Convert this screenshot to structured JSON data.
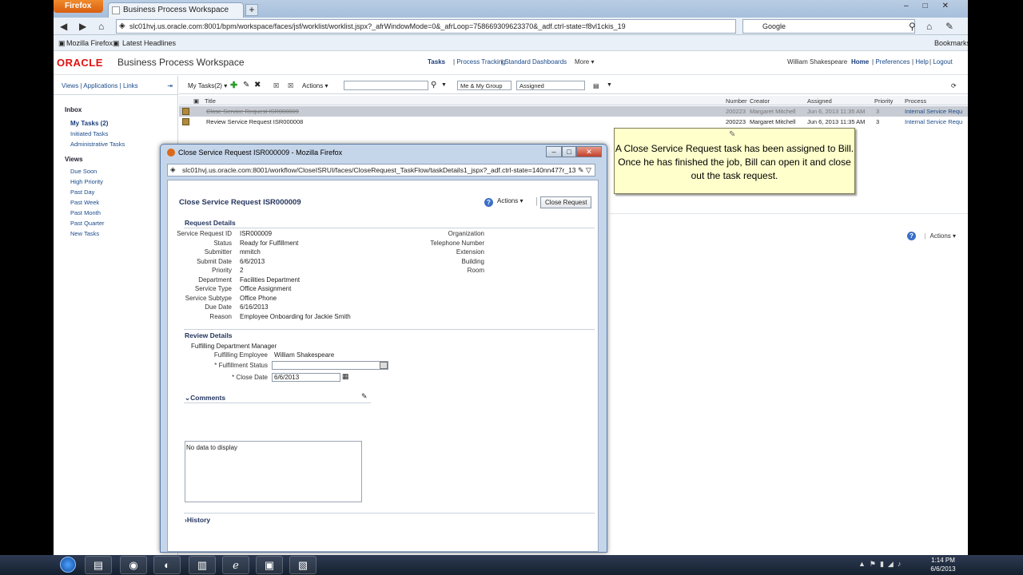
{
  "browser": {
    "button": "Firefox",
    "tab_title": "Business Process Workspace",
    "url": "slc01hvj.us.oracle.com:8001/bpm/workspace/faces/jsf/worklist/worklist.jspx?_afrWindowMode=0&_afrLoop=758669309623370&_adf.ctrl-state=f8vl1ckis_19",
    "search_placeholder": "Google",
    "bookmarks": [
      "Mozilla Firefox",
      "Latest Headlines"
    ],
    "bookmarks_menu": "Bookmarks"
  },
  "header": {
    "logo": "ORACLE",
    "app_title": "Business Process Workspace",
    "nav": [
      "Tasks",
      "Process Tracking",
      "Standard Dashboards",
      "More ▾"
    ],
    "user": "William Shakespeare",
    "links": [
      "Home",
      "Preferences",
      "Help",
      "Logout"
    ]
  },
  "sidebar": {
    "tabs": [
      "Views",
      "Applications",
      "Links"
    ],
    "inbox_heading": "Inbox",
    "inbox": [
      "My Tasks (2)",
      "Initiated Tasks",
      "Administrative Tasks"
    ],
    "views_heading": "Views",
    "views": [
      "Due Soon",
      "High Priority",
      "Past Day",
      "Past Week",
      "Past Month",
      "Past Quarter",
      "New Tasks"
    ]
  },
  "toolbar": {
    "my_tasks": "My Tasks(2) ▾",
    "actions": "Actions ▾",
    "group_filter": "Me & My Group",
    "state_filter": "Assigned"
  },
  "worklist": {
    "columns": [
      "Title",
      "Number",
      "Creator",
      "Assigned",
      "Priority",
      "Process"
    ],
    "rows": [
      {
        "title": "Close Service Request ISR000009",
        "number": "200223",
        "creator": "Margaret Mitchell",
        "assigned": "Jun 6, 2013 11:35 AM",
        "priority": "3",
        "process": "Internal Service Requ"
      },
      {
        "title": "Review Service Request ISR000008",
        "number": "200223",
        "creator": "Margaret Mitchell",
        "assigned": "Jun 6, 2013 11:35 AM",
        "priority": "3",
        "process": "Internal Service Requ"
      }
    ]
  },
  "detail_panel": {
    "actions": "Actions ▾"
  },
  "callout": {
    "text": "A Close Service Request task has been assigned to Bill. Once he has finished the job, Bill can open it and close out the task request."
  },
  "popup": {
    "window_title": "Close Service Request ISR000009 - Mozilla Firefox",
    "url": "slc01hvj.us.oracle.com:8001/workflow/CloseISRUI/faces/CloseRequest_TaskFlow/taskDetails1_jspx?_adf.ctrl-state=140nn477r_13",
    "form_title": "Close Service Request ISR000009",
    "actions": "Actions ▾",
    "close_button": "Close Request",
    "request_details_heading": "Request Details",
    "request_fields": [
      {
        "label": "Service Request ID",
        "value": "ISR000009"
      },
      {
        "label": "Status",
        "value": "Ready for Fulfillment"
      },
      {
        "label": "Submitter",
        "value": "mmitch"
      },
      {
        "label": "Submit Date",
        "value": "6/6/2013"
      },
      {
        "label": "Priority",
        "value": "2"
      },
      {
        "label": "Department",
        "value": "Facilities Department"
      },
      {
        "label": "Service Type",
        "value": "Office Assignment"
      },
      {
        "label": "Service Subtype",
        "value": "Office Phone"
      },
      {
        "label": "Due Date",
        "value": "6/16/2013"
      },
      {
        "label": "Reason",
        "value": "Employee Onboarding for Jackie Smith"
      }
    ],
    "right_fields": [
      "Organization",
      "Telephone Number",
      "Extension",
      "Building",
      "Room"
    ],
    "review_heading": "Review Details",
    "review_manager_label": "Fulfilling Department Manager",
    "review_employee_label": "Fulfilling Employee",
    "review_employee_value": "William Shakespeare",
    "fulfillment_status_label": "* Fulfillment Status",
    "close_date_label": "* Close Date",
    "close_date_value": "6/6/2013",
    "comments_heading": "Comments",
    "comments_empty": "No data to display",
    "history_heading": "History"
  },
  "taskbar": {
    "time": "1:14 PM",
    "date": "6/6/2013"
  }
}
